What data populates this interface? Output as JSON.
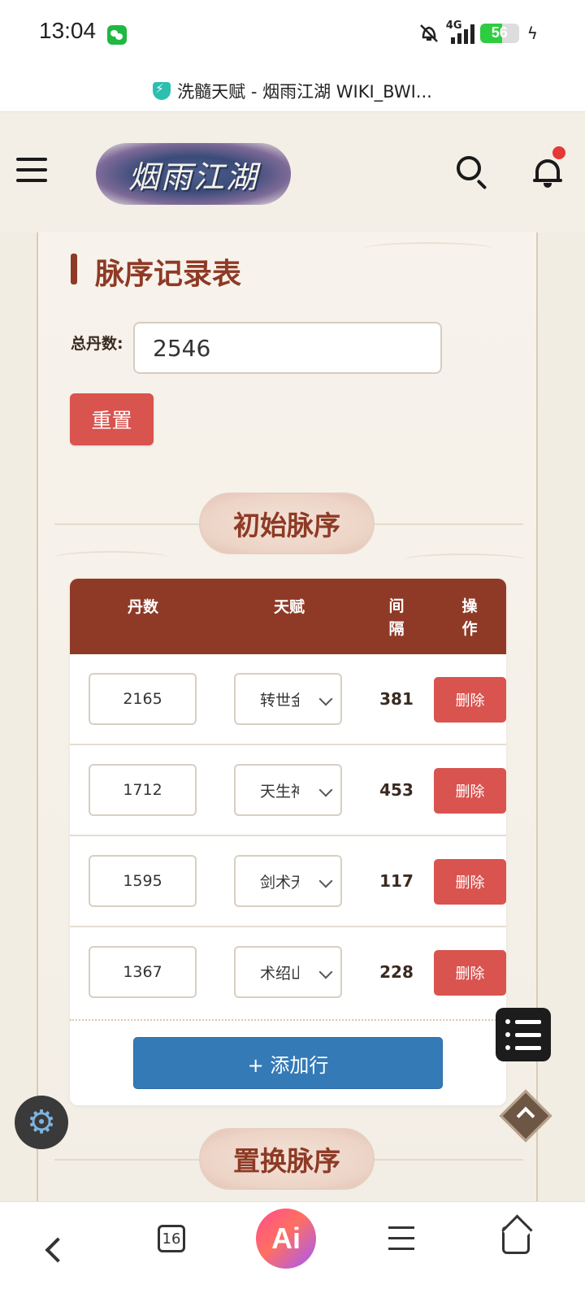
{
  "status_bar": {
    "time": "13:04",
    "network": "4G",
    "battery": "56",
    "icons": [
      "wechat-icon",
      "mute-bell-icon",
      "signal-icon",
      "battery-icon",
      "charging-icon"
    ]
  },
  "browser": {
    "page_title": "洗髓天赋 - 烟雨江湖 WIKI_BWI...",
    "tab_count": "16",
    "ai_label": "Ai"
  },
  "site_header": {
    "logo_text": "烟雨江湖",
    "icons": [
      "menu-icon",
      "search-icon",
      "bell-icon"
    ]
  },
  "main": {
    "title": "脉序记录表",
    "total_label": "总丹数:",
    "total_value": "2546",
    "reset_label": "重置",
    "section_initial": "初始脉序",
    "section_replace": "置换脉序",
    "table": {
      "headers": {
        "dan": "丹数",
        "talent": "天赋",
        "gap_1": "间",
        "gap_2": "隔",
        "op_1": "操",
        "op_2": "作"
      },
      "rows": [
        {
          "dan": "2165",
          "talent": "转世金",
          "gap": "381",
          "action": "删除"
        },
        {
          "dan": "1712",
          "talent": "天生神",
          "gap": "453",
          "action": "删除"
        },
        {
          "dan": "1595",
          "talent": "剑术无",
          "gap": "117",
          "action": "删除"
        },
        {
          "dan": "1367",
          "talent": "术绍山",
          "gap": "228",
          "action": "删除"
        }
      ],
      "add_row_label": "+ 添加行"
    }
  },
  "colors": {
    "accent": "#8e3a25",
    "danger": "#d9534f",
    "primary": "#337ab7",
    "page_bg": "#f2ede3"
  }
}
